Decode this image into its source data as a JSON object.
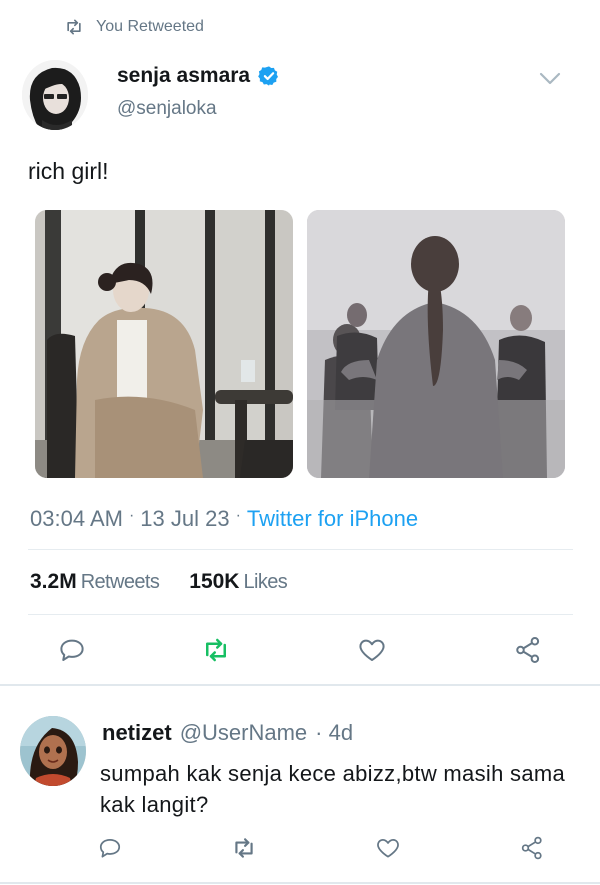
{
  "retweet_header": {
    "label": "You Retweeted",
    "icon": "retweet-icon"
  },
  "tweet": {
    "display_name": "senja asmara",
    "handle": "@senjaloka",
    "verified": true,
    "text": "rich girl!",
    "time": "03:04 AM",
    "date": "13 Jul 23",
    "source": "Twitter for iPhone",
    "retweets_count": "3.2M",
    "retweets_label": "Retweets",
    "likes_count": "150K",
    "likes_label": "Likes",
    "media": [
      {
        "description_icon": "photo-woman-in-suit-seated"
      },
      {
        "description_icon": "photo-woman-presenting"
      }
    ]
  },
  "reply": {
    "display_name": "netizet",
    "handle": "@UserName",
    "age": "· 4d",
    "text": "sumpah kak senja kece abizz,btw masih sama kak langit?"
  },
  "colors": {
    "accent": "#1da1f2",
    "retweet_active": "#17bf63",
    "muted": "#657786",
    "text": "#14171a"
  }
}
